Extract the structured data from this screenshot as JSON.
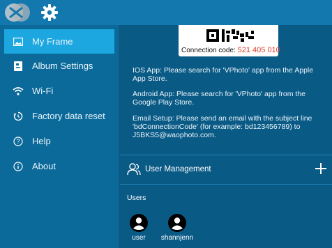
{
  "colors": {
    "topbar": "#1378ae",
    "sidebar": "#0b6a9a",
    "active": "#1ca7e0",
    "main": "#0a5a86",
    "connection_number": "#e33a2d"
  },
  "sidebar": {
    "items": [
      {
        "label": "My Frame",
        "icon": "picture-icon",
        "active": true
      },
      {
        "label": "Album Settings",
        "icon": "album-icon",
        "active": false
      },
      {
        "label": "Wi-Fi",
        "icon": "wifi-icon",
        "active": false
      },
      {
        "label": "Factory data reset",
        "icon": "reset-icon",
        "active": false
      },
      {
        "label": "Help",
        "icon": "help-icon",
        "active": false
      },
      {
        "label": "About",
        "icon": "info-icon",
        "active": false
      }
    ]
  },
  "main": {
    "connection_label": "Connection code:",
    "connection_code": "521 405 010",
    "instructions": [
      "IOS App: Please search for 'VPhoto' app from the Apple App Store.",
      "Android App: Please search for 'VPhoto' app from the Google Play Store.",
      "Email Setup: Please send an email with the subject line 'bdConnectionCode' (for example: bd123456789) to J5BKS5@waophoto.com."
    ],
    "user_management_label": "User Management",
    "users_label": "Users",
    "users": [
      "user",
      "shannjenn"
    ]
  }
}
